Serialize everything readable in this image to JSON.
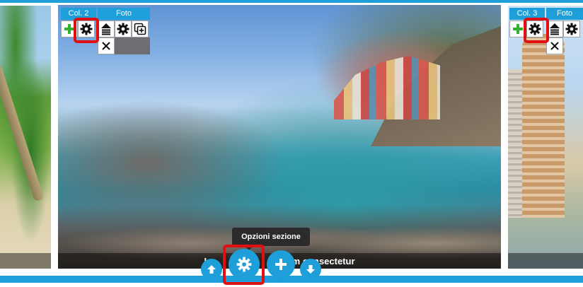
{
  "colors": {
    "accent": "#1e9fd9",
    "highlight": "#e01010",
    "add_green": "#2fb32f"
  },
  "toolbars": {
    "main": {
      "col_label": "Col. 2",
      "foto_label": "Foto"
    },
    "right": {
      "col_label": "Col. 3",
      "foto_label": "Foto"
    }
  },
  "caption": {
    "text": "Lo                              m consectetur"
  },
  "tooltip": {
    "text": "Opzioni sezione"
  },
  "bottom_controls": [
    "arrow-up-icon",
    "gear-icon",
    "plus-icon",
    "arrow-down-icon"
  ],
  "icons": [
    "plus-icon",
    "gear-icon",
    "move-up-icon",
    "duplicate-icon",
    "close-icon"
  ]
}
